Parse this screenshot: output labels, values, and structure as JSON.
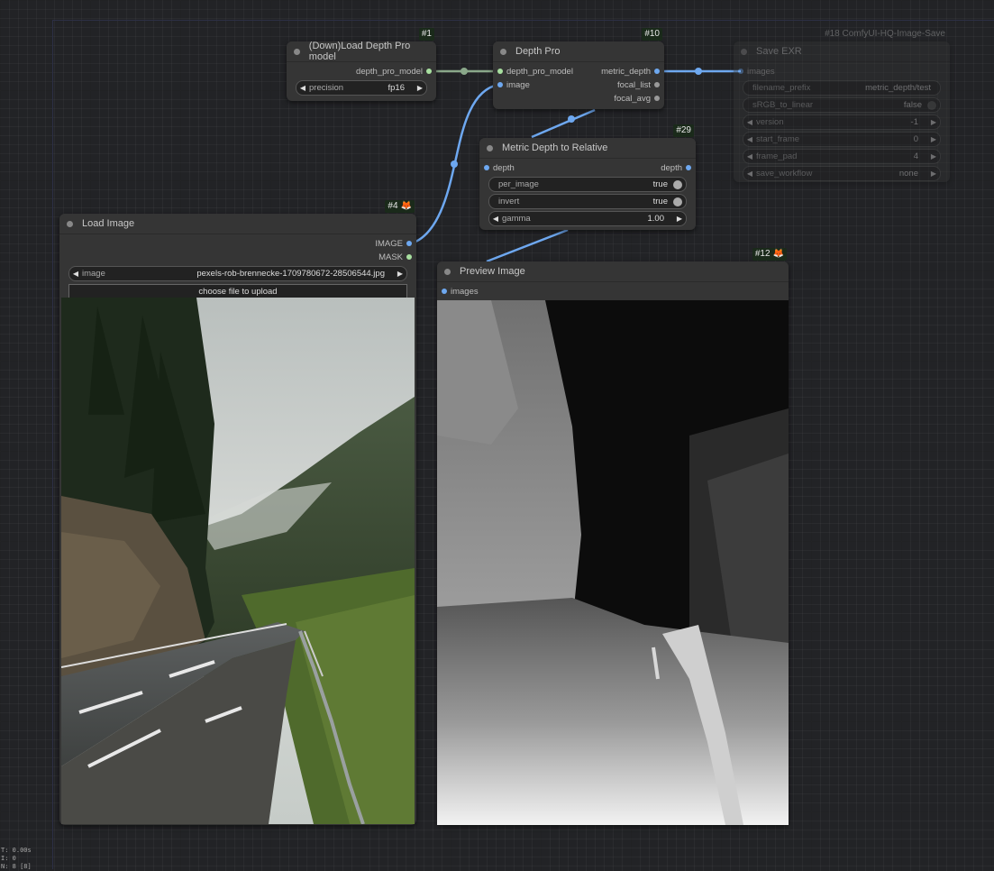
{
  "nodes": {
    "load_depth": {
      "id": "#1",
      "title": "(Down)Load Depth Pro model",
      "outputs": [
        "depth_pro_model"
      ],
      "widgets": [
        {
          "label": "precision",
          "value": "fp16"
        }
      ]
    },
    "depth_pro": {
      "id": "#10",
      "title": "Depth Pro",
      "inputs": [
        "depth_pro_model",
        "image"
      ],
      "outputs": [
        "metric_depth",
        "focal_list",
        "focal_avg"
      ]
    },
    "save_exr": {
      "id": "#18 ComfyUI-HQ-Image-Save",
      "title": "Save EXR",
      "inputs": [
        "images"
      ],
      "widgets": [
        {
          "label": "filename_prefix",
          "value": "metric_depth/test"
        },
        {
          "label": "sRGB_to_linear",
          "value": "false"
        },
        {
          "label": "version",
          "value": "-1"
        },
        {
          "label": "start_frame",
          "value": "0"
        },
        {
          "label": "frame_pad",
          "value": "4"
        },
        {
          "label": "save_workflow",
          "value": "none"
        }
      ]
    },
    "metric_relative": {
      "id": "#29",
      "title": "Metric Depth to Relative",
      "inputs": [
        "depth"
      ],
      "outputs": [
        "depth"
      ],
      "widgets": [
        {
          "label": "per_image",
          "value": "true"
        },
        {
          "label": "invert",
          "value": "true"
        },
        {
          "label": "gamma",
          "value": "1.00"
        }
      ]
    },
    "load_image": {
      "id": "#4",
      "title": "Load Image",
      "outputs": [
        "IMAGE",
        "MASK"
      ],
      "widgets": [
        {
          "label": "image",
          "value": "pexels-rob-brennecke-1709780672-28506544.jpg"
        }
      ],
      "upload_label": "choose file to upload"
    },
    "preview_image": {
      "id": "#12",
      "title": "Preview Image",
      "inputs": [
        "images"
      ]
    }
  },
  "stats": {
    "t": "T: 0.00s",
    "i": "I: 0",
    "n": "N: 8 [8]"
  },
  "colors": {
    "link_image": "#6ea8f0",
    "link_model": "#8aa88a",
    "canvas": "#222326",
    "node": "#353535"
  }
}
